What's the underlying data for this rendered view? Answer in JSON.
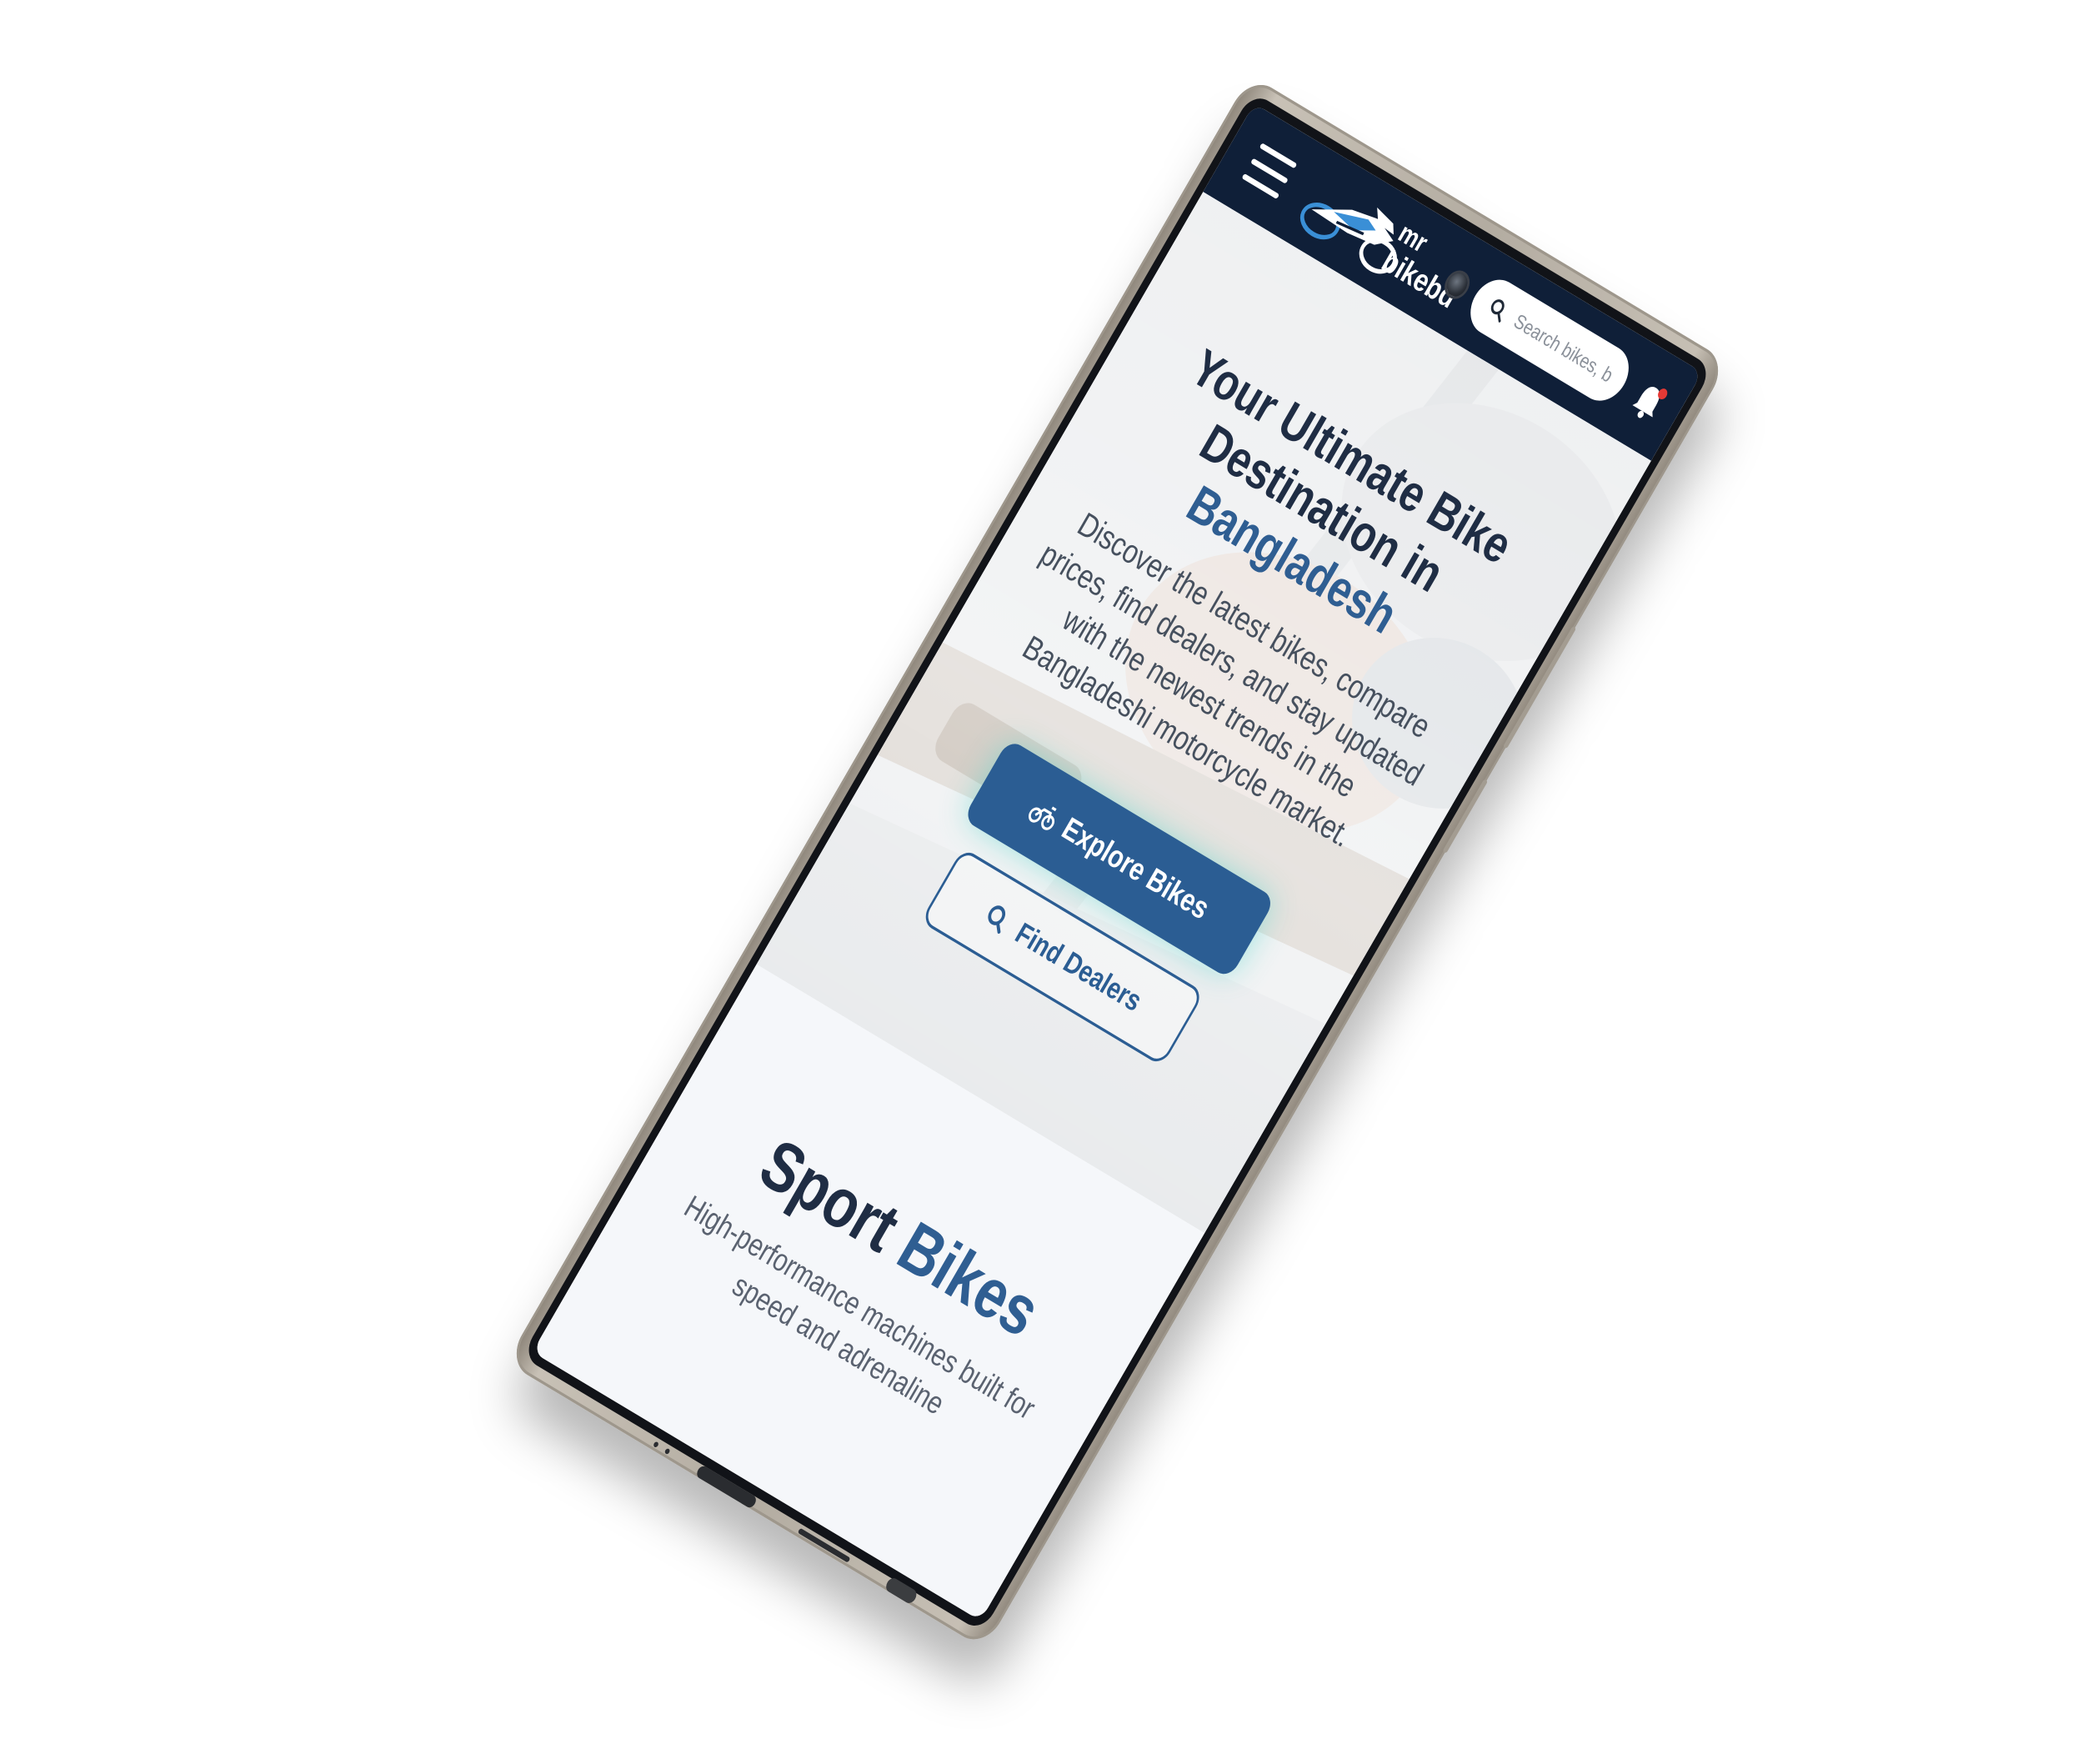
{
  "brand": {
    "name_top": "mr",
    "name_bottom": "bikebd",
    "primary_color": "#2b5d93",
    "dark_color": "#0f1f38"
  },
  "nav": {
    "menu_icon": "hamburger-menu-icon",
    "search_placeholder": "Search bikes, b",
    "search_icon": "search-icon",
    "notification_icon": "bell-icon"
  },
  "hero": {
    "title_line1": "Your Ultimate Bike",
    "title_line2_prefix": "Destination in",
    "title_line2_accent": "Bangladesh",
    "subtitle": "Discover the latest bikes, compare prices, find dealers, and stay updated with the newest trends in the Bangladeshi motorcycle market.",
    "primary_button": "Explore Bikes",
    "primary_button_icon": "motorcycle-icon",
    "secondary_button": "Find Dealers",
    "secondary_button_icon": "search-icon"
  },
  "section": {
    "title_prefix": "Sport",
    "title_accent": "Bikes",
    "subtitle": "High-performance machines built for speed and adrenaline"
  }
}
